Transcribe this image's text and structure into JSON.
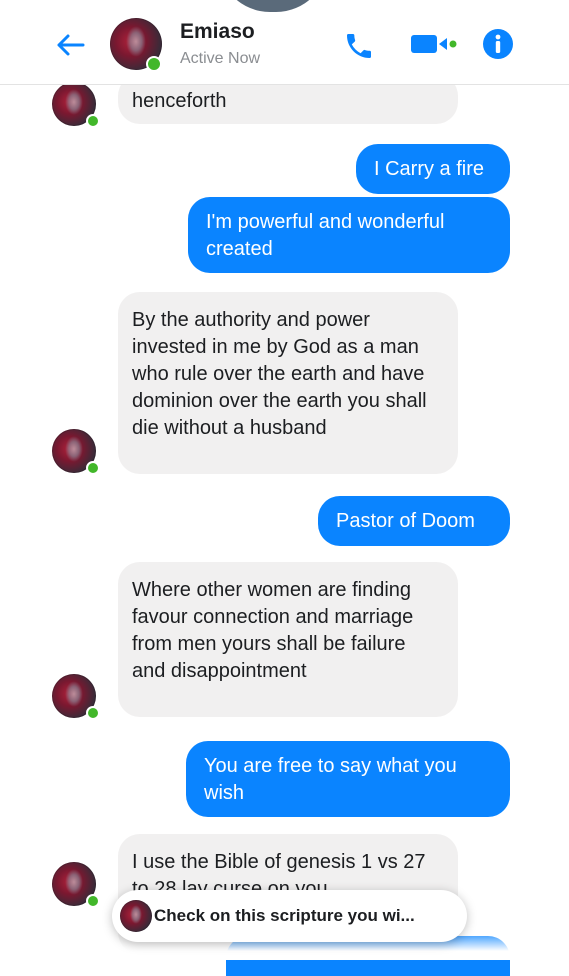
{
  "header": {
    "contact_name": "Emiaso",
    "status": "Active Now",
    "icons": [
      "back-arrow-icon",
      "phone-icon",
      "video-camera-icon",
      "info-icon"
    ],
    "accent_color": "#0a84ff"
  },
  "messages": [
    {
      "side": "incoming",
      "text": "henceforth"
    },
    {
      "side": "outgoing",
      "text": "I Carry a fire"
    },
    {
      "side": "outgoing",
      "text": "I'm powerful and wonderful created"
    },
    {
      "side": "incoming",
      "text": "By the authority and power invested in me by God as a man who rule over the earth and have dominion over the earth you shall die without a husband"
    },
    {
      "side": "outgoing",
      "text": "Pastor of Doom"
    },
    {
      "side": "incoming",
      "text": "Where other women are finding favour connection and marriage from men yours shall be failure and disappointment"
    },
    {
      "side": "outgoing",
      "text": "You are free to say what you wish"
    },
    {
      "side": "incoming",
      "text": "I use the Bible of genesis 1 vs 27 to 28 lay curse on you"
    }
  ],
  "preview": {
    "text": "Check on this scripture you wi..."
  }
}
